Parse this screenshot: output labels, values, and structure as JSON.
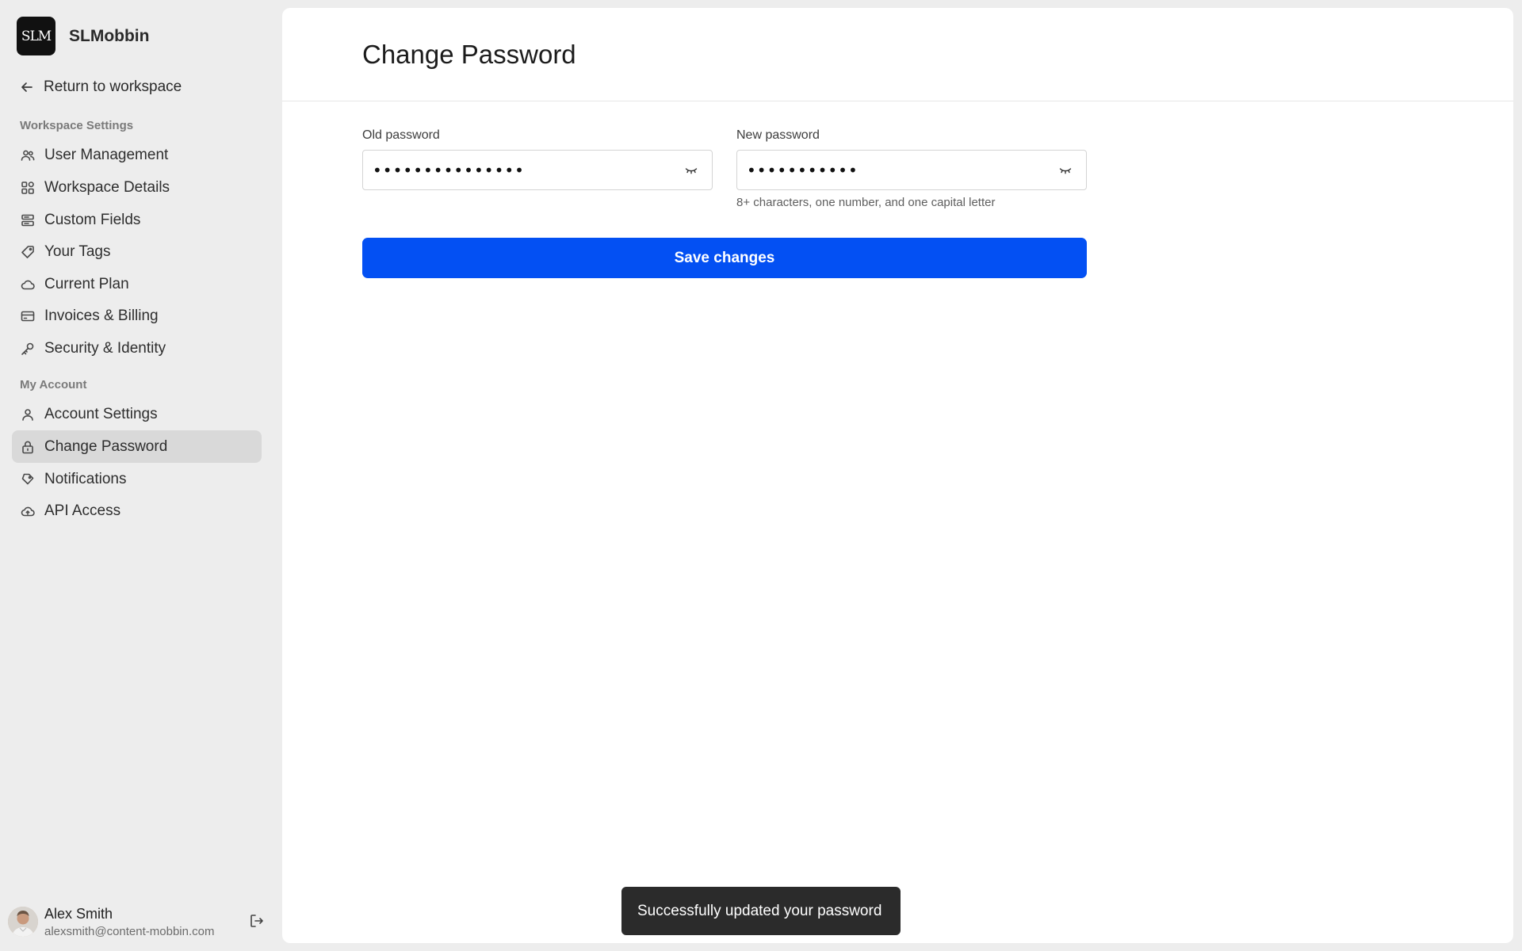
{
  "brand": {
    "logo_text": "SLM",
    "name": "SLMobbin"
  },
  "sidebar": {
    "return_label": "Return to workspace",
    "workspace_section": "Workspace Settings",
    "workspace_items": [
      {
        "label": "User Management",
        "icon": "users-icon"
      },
      {
        "label": "Workspace Details",
        "icon": "grid-icon"
      },
      {
        "label": "Custom Fields",
        "icon": "fields-icon"
      },
      {
        "label": "Your Tags",
        "icon": "tag-icon"
      },
      {
        "label": "Current Plan",
        "icon": "cloud-icon"
      },
      {
        "label": "Invoices & Billing",
        "icon": "card-icon"
      },
      {
        "label": "Security & Identity",
        "icon": "key-icon"
      }
    ],
    "account_section": "My Account",
    "account_items": [
      {
        "label": "Account Settings",
        "icon": "user-icon"
      },
      {
        "label": "Change Password",
        "icon": "lock-icon",
        "active": true
      },
      {
        "label": "Notifications",
        "icon": "bell-icon"
      },
      {
        "label": "API Access",
        "icon": "cloud-upload-icon"
      }
    ]
  },
  "user": {
    "name": "Alex Smith",
    "email": "alexsmith@content-mobbin.com"
  },
  "main": {
    "title": "Change Password",
    "old_password": {
      "label": "Old password",
      "value": "•••••••••••••••"
    },
    "new_password": {
      "label": "New password",
      "value": "•••••••••••",
      "hint": "8+ characters, one number, and one capital letter"
    },
    "save_label": "Save changes"
  },
  "toast": {
    "message": "Successfully updated your password"
  },
  "colors": {
    "accent": "#0350f3",
    "sidebar_bg": "#ededed",
    "active_item": "#d9d9d9",
    "toast_bg": "#2b2b2b"
  }
}
